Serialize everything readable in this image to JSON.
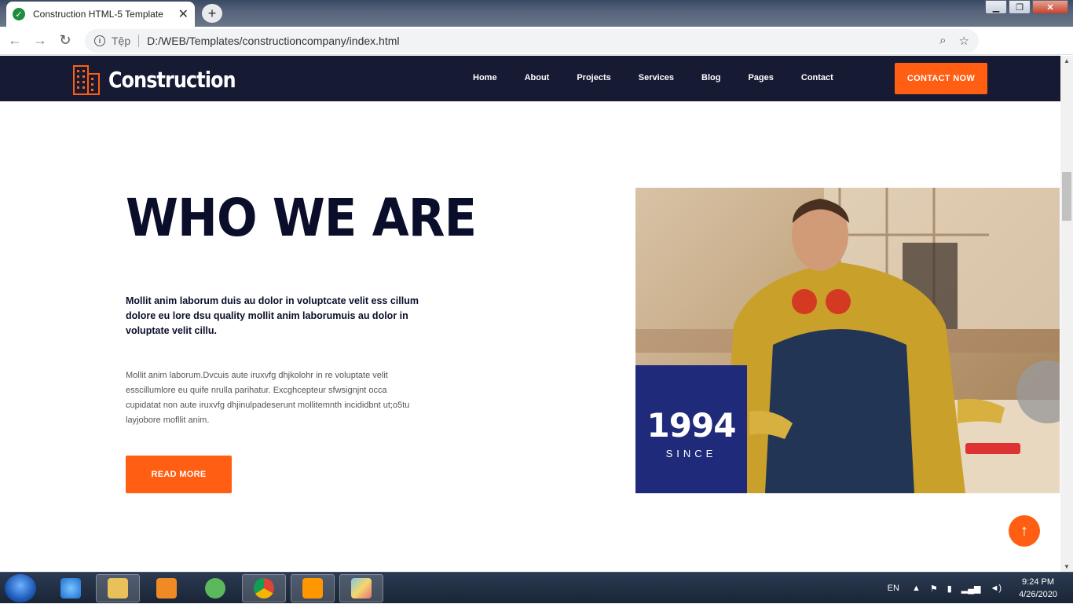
{
  "browser": {
    "tab_title": "Construction HTML-5 Template",
    "security_label": "Tệp",
    "url": "D:/WEB/Templates/constructioncompany/index.html"
  },
  "site": {
    "logo_text": "Construction",
    "nav": [
      "Home",
      "About",
      "Projects",
      "Services",
      "Blog",
      "Pages",
      "Contact"
    ],
    "contact_button": "CONTACT NOW"
  },
  "section": {
    "heading": "WHO WE ARE",
    "lead": "Mollit anim laborum duis au dolor in voluptcate velit ess cillum dolore eu lore dsu quality mollit anim laborumuis au dolor in voluptate velit cillu.",
    "body": "Mollit anim laborum.Dvcuis aute iruxvfg dhjkolohr in re voluptate velit esscillumlore eu quife nrulla parihatur. Excghcepteur sfwsignjnt occa cupidatat non aute iruxvfg dhjinulpadeserunt mollitemnth incididbnt ut;o5tu layjobore mofllit anim.",
    "read_more": "READ MORE",
    "year": "1994",
    "since": "SINCE"
  },
  "taskbar": {
    "lang": "EN",
    "time": "9:24 PM",
    "date": "4/26/2020"
  },
  "colors": {
    "accent": "#ff5e13",
    "navy": "#161a33",
    "badge": "#1f2b7a"
  }
}
